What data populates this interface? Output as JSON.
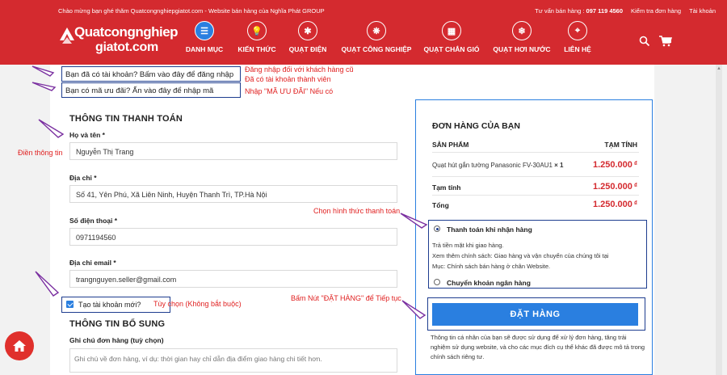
{
  "header": {
    "welcome": "Chào mừng bạn ghé thăm Quatcongnghiepgiatot.com - Website bán hàng của Nghĩa Phát GROUP",
    "hotline_label": "Tư vấn bán hàng :",
    "hotline": "097 119 4560",
    "check_order": "Kiểm tra đơn hàng",
    "account": "Tài khoản",
    "logo_line1": "Quatcongnghiep",
    "logo_line2": "giatot.com",
    "nav": [
      {
        "label": "DANH MỤC",
        "icon": "☰"
      },
      {
        "label": "KIẾN THỨC",
        "icon": "💡"
      },
      {
        "label": "QUẠT ĐIỆN",
        "icon": "✱"
      },
      {
        "label": "QUẠT CÔNG NGHIỆP",
        "icon": "❋"
      },
      {
        "label": "QUẠT CHẮN GIÓ",
        "icon": "▦"
      },
      {
        "label": "QUẠT HƠI NƯỚC",
        "icon": "❄"
      },
      {
        "label": "LIÊN HỆ",
        "icon": "⌖"
      }
    ]
  },
  "notices": {
    "login": "Bạn đã có tài khoản? Bấm vào đây để đăng nhập",
    "coupon": "Bạn có mã ưu đãi? Ấn vào đây để nhập mã"
  },
  "annotations": {
    "login1": "Đăng nhập đối với khách hàng cũ",
    "login2": "Đã có tài khoản thành viên",
    "coupon": "Nhập \"MÃ ƯU ĐÃI\" Nếu có",
    "fill": "Điền thông tin",
    "payment": "Chọn hình thức thanh toán",
    "optional": "Tùy  chọn (Không bắt buộc)",
    "order": "Bấm Nút \"ĐẶT HÀNG\" để Tiếp tục"
  },
  "billing": {
    "title": "THÔNG TIN THANH TOÁN",
    "name_label": "Họ và tên",
    "name_value": "Nguyễn Thị Trang",
    "address_label": "Địa chỉ",
    "address_value": "Số 41, Yên Phú, Xã Liên Ninh, Huyện Thanh Trì, TP.Hà Nội",
    "phone_label": "Số điện thoại",
    "phone_value": "0971194560",
    "email_label": "Địa chỉ email",
    "email_value": "trangnguyen.seller@gmail.com",
    "required_mark": "*",
    "create_account": "Tạo tài khoản mới?"
  },
  "additional": {
    "title": "THÔNG TIN BỔ SUNG",
    "notes_label": "Ghi chú đơn hàng (tuỳ chọn)",
    "notes_placeholder": "Ghi chú về đơn hàng, ví dụ: thời gian hay chỉ dẫn địa điểm giao hàng chi tiết hơn."
  },
  "order": {
    "title": "ĐƠN HÀNG CỦA BẠN",
    "col_product": "SẢN PHẨM",
    "col_subtotal": "TẠM TÍNH",
    "product_name": "Quạt hút gắn tường Panasonic FV-30AU1",
    "product_qty": "× 1",
    "product_price": "1.250.000",
    "subtotal_label": "Tạm tính",
    "subtotal": "1.250.000",
    "total_label": "Tổng",
    "total": "1.250.000",
    "currency": "₫",
    "pay_cod": "Thanh toán khi nhận hàng",
    "pay_cod_desc1": "Trả tiền mặt khi giao hàng.",
    "pay_cod_desc2": "Xem thêm chính sách: Giao hàng và vận chuyển của chúng tôi tại",
    "pay_cod_desc3": "Mục: Chính sách bán hàng ở chân Website.",
    "pay_bank": "Chuyển khoản ngân hàng",
    "button": "ĐẶT HÀNG",
    "privacy": "Thông tin cá nhân của bạn sẽ được sử dụng để xử lý đơn hàng, tăng trải nghiệm sử dụng website, và cho các mục đích cụ thể khác đã được mô tả trong chính sách riêng tư."
  },
  "colors": {
    "brand_red": "#d42a2f",
    "accent_blue": "#2a7fe0",
    "annotation_red": "#e01f1f",
    "box_navy": "#1e3d8f"
  }
}
